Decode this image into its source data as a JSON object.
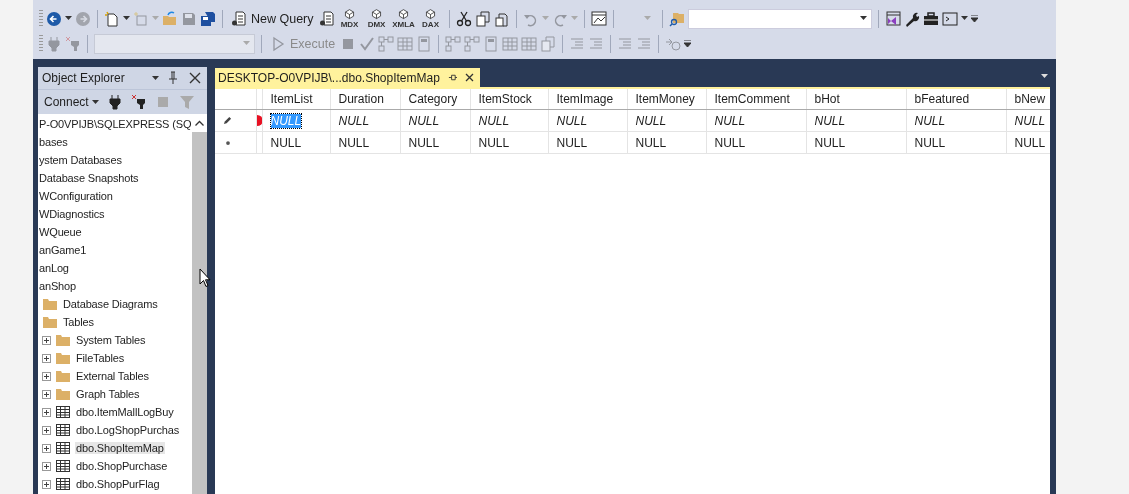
{
  "toolbar_rows": [
    {
      "items": [
        {
          "kind": "grip"
        },
        {
          "kind": "icon",
          "disabled": false
        },
        {
          "kind": "caret",
          "disabled": false
        },
        {
          "kind": "icon",
          "disabled": true
        },
        {
          "kind": "sep"
        },
        {
          "kind": "icon",
          "disabled": false
        },
        {
          "kind": "caret",
          "disabled": false
        },
        {
          "kind": "icon",
          "disabled": true
        },
        {
          "kind": "caret",
          "disabled": true
        },
        {
          "kind": "icon",
          "disabled": false
        },
        {
          "kind": "icon",
          "disabled": true
        },
        {
          "kind": "icon",
          "disabled": false
        },
        {
          "kind": "sep"
        },
        {
          "kind": "button",
          "label": "New Query",
          "disabled": false
        },
        {
          "kind": "icon",
          "disabled": false
        },
        {
          "kind": "cube",
          "label": "MDX",
          "disabled": false
        },
        {
          "kind": "cube",
          "label": "DMX",
          "disabled": false
        },
        {
          "kind": "cube",
          "label": "XMLA",
          "disabled": false
        },
        {
          "kind": "cube",
          "label": "DAX",
          "disabled": false
        },
        {
          "kind": "sep"
        },
        {
          "kind": "icon",
          "disabled": false
        },
        {
          "kind": "icon",
          "disabled": false
        },
        {
          "kind": "icon",
          "disabled": false
        },
        {
          "kind": "sep"
        },
        {
          "kind": "icon",
          "disabled": true
        },
        {
          "kind": "caret",
          "disabled": true
        },
        {
          "kind": "icon",
          "disabled": true
        },
        {
          "kind": "caret",
          "disabled": true
        },
        {
          "kind": "sep"
        },
        {
          "kind": "icon",
          "disabled": false
        },
        {
          "kind": "sep"
        },
        {
          "kind": "combo",
          "disabled": true
        },
        {
          "kind": "sep"
        },
        {
          "kind": "icon",
          "disabled": false
        },
        {
          "kind": "combo",
          "disabled": false
        },
        {
          "kind": "sep"
        },
        {
          "kind": "icon",
          "disabled": false
        },
        {
          "kind": "icon",
          "disabled": false
        },
        {
          "kind": "icon",
          "disabled": false
        },
        {
          "kind": "icon",
          "disabled": false
        },
        {
          "kind": "caret",
          "disabled": false
        },
        {
          "kind": "overflow"
        }
      ]
    },
    {
      "items": [
        {
          "kind": "grip"
        },
        {
          "kind": "icon",
          "disabled": true
        },
        {
          "kind": "icon",
          "disabled": true
        },
        {
          "kind": "sep"
        },
        {
          "kind": "combo",
          "disabled": true
        },
        {
          "kind": "sep"
        },
        {
          "kind": "button",
          "label": "Execute",
          "disabled": true
        },
        {
          "kind": "icon",
          "disabled": true
        },
        {
          "kind": "icon",
          "disabled": true
        },
        {
          "kind": "icon",
          "disabled": true
        },
        {
          "kind": "icon",
          "disabled": true
        },
        {
          "kind": "icon",
          "disabled": true
        },
        {
          "kind": "sep"
        },
        {
          "kind": "icon",
          "disabled": true
        },
        {
          "kind": "icon",
          "disabled": true
        },
        {
          "kind": "icon",
          "disabled": true
        },
        {
          "kind": "icon",
          "disabled": true
        },
        {
          "kind": "icon",
          "disabled": true
        },
        {
          "kind": "icon",
          "disabled": true
        },
        {
          "kind": "sep"
        },
        {
          "kind": "icon",
          "disabled": true
        },
        {
          "kind": "icon",
          "disabled": true
        },
        {
          "kind": "sep"
        },
        {
          "kind": "icon",
          "disabled": true
        },
        {
          "kind": "icon",
          "disabled": true
        },
        {
          "kind": "sep"
        },
        {
          "kind": "icon",
          "disabled": true
        },
        {
          "kind": "overflow"
        }
      ]
    }
  ],
  "object_explorer": {
    "title": "Object Explorer",
    "connect": "Connect",
    "tree": [
      {
        "label": "P-O0VPIJB\\SQLEXPRESS (SQ"
      },
      {
        "label": "bases"
      },
      {
        "label": "ystem Databases"
      },
      {
        "label": "Database Snapshots"
      },
      {
        "label": "WConfiguration"
      },
      {
        "label": "WDiagnostics"
      },
      {
        "label": "WQueue"
      },
      {
        "label": "anGame1"
      },
      {
        "label": "anLog"
      },
      {
        "label": "anShop",
        "children": [
          {
            "label": "Database Diagrams",
            "kind": "folder"
          },
          {
            "label": "Tables",
            "kind": "folder",
            "children": [
              {
                "label": "System Tables",
                "kind": "folder",
                "expanded": false
              },
              {
                "label": "FileTables",
                "kind": "folder",
                "expanded": false
              },
              {
                "label": "External Tables",
                "kind": "folder",
                "expanded": false
              },
              {
                "label": "Graph Tables",
                "kind": "folder",
                "expanded": false
              },
              {
                "label": "dbo.ItemMallLogBuy",
                "kind": "table",
                "expanded": false,
                "selected": false
              },
              {
                "label": "dbo.LogShopPurchas",
                "kind": "table",
                "expanded": false,
                "selected": false
              },
              {
                "label": "dbo.ShopItemMap",
                "kind": "table",
                "expanded": false,
                "selected": true
              },
              {
                "label": "dbo.ShopPurchase",
                "kind": "table",
                "expanded": false,
                "selected": false
              },
              {
                "label": "dbo.ShopPurFlag",
                "kind": "table",
                "expanded": false,
                "selected": false
              }
            ]
          }
        ]
      }
    ]
  },
  "document_tab": {
    "title": "DESKTOP-O0VPIJB\\...dbo.ShopItemMap",
    "selected": true
  },
  "table": {
    "columns": [
      "ItemList",
      "Duration",
      "Category",
      "ItemStock",
      "ItemImage",
      "ItemMoney",
      "ItemComment",
      "bHot",
      "bFeatured",
      "bNew"
    ],
    "rows": [
      {
        "kind": "editing",
        "cells": [
          {
            "text": "NULL",
            "selected": true
          },
          {
            "text": "NULL",
            "selected": false
          },
          {
            "text": "NULL",
            "selected": false
          },
          {
            "text": "NULL",
            "selected": false
          },
          {
            "text": "NULL",
            "selected": false
          },
          {
            "text": "NULL",
            "selected": false
          },
          {
            "text": "NULL",
            "selected": false
          },
          {
            "text": "NULL",
            "selected": false
          },
          {
            "text": "NULL",
            "selected": false
          },
          {
            "text": "NULL",
            "selected": false
          }
        ]
      },
      {
        "kind": "new",
        "cells": [
          {
            "text": "NULL",
            "selected": false
          },
          {
            "text": "NULL",
            "selected": false
          },
          {
            "text": "NULL",
            "selected": false
          },
          {
            "text": "NULL",
            "selected": false
          },
          {
            "text": "NULL",
            "selected": false
          },
          {
            "text": "NULL",
            "selected": false
          },
          {
            "text": "NULL",
            "selected": false
          },
          {
            "text": "NULL",
            "selected": false
          },
          {
            "text": "NULL",
            "selected": false
          },
          {
            "text": "NULL",
            "selected": false
          }
        ]
      }
    ]
  }
}
